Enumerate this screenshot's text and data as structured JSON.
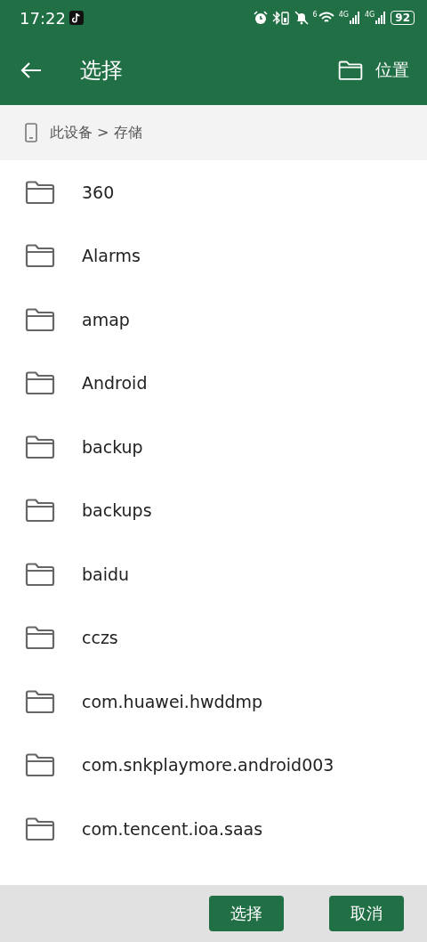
{
  "status_bar": {
    "time": "17:22",
    "signal_1": "4G",
    "signal_2": "4G",
    "wifi_label": "6",
    "battery": "92"
  },
  "toolbar": {
    "title": "选择",
    "action": "位置"
  },
  "breadcrumb": "此设备 > 存储",
  "folders": [
    {
      "name": "360"
    },
    {
      "name": "Alarms"
    },
    {
      "name": "amap"
    },
    {
      "name": "Android"
    },
    {
      "name": "backup"
    },
    {
      "name": "backups"
    },
    {
      "name": "baidu"
    },
    {
      "name": "cczs"
    },
    {
      "name": "com.huawei.hwddmp"
    },
    {
      "name": "com.snkplaymore.android003"
    },
    {
      "name": "com.tencent.ioa.saas"
    }
  ],
  "buttons": [
    "选择",
    "取消"
  ]
}
